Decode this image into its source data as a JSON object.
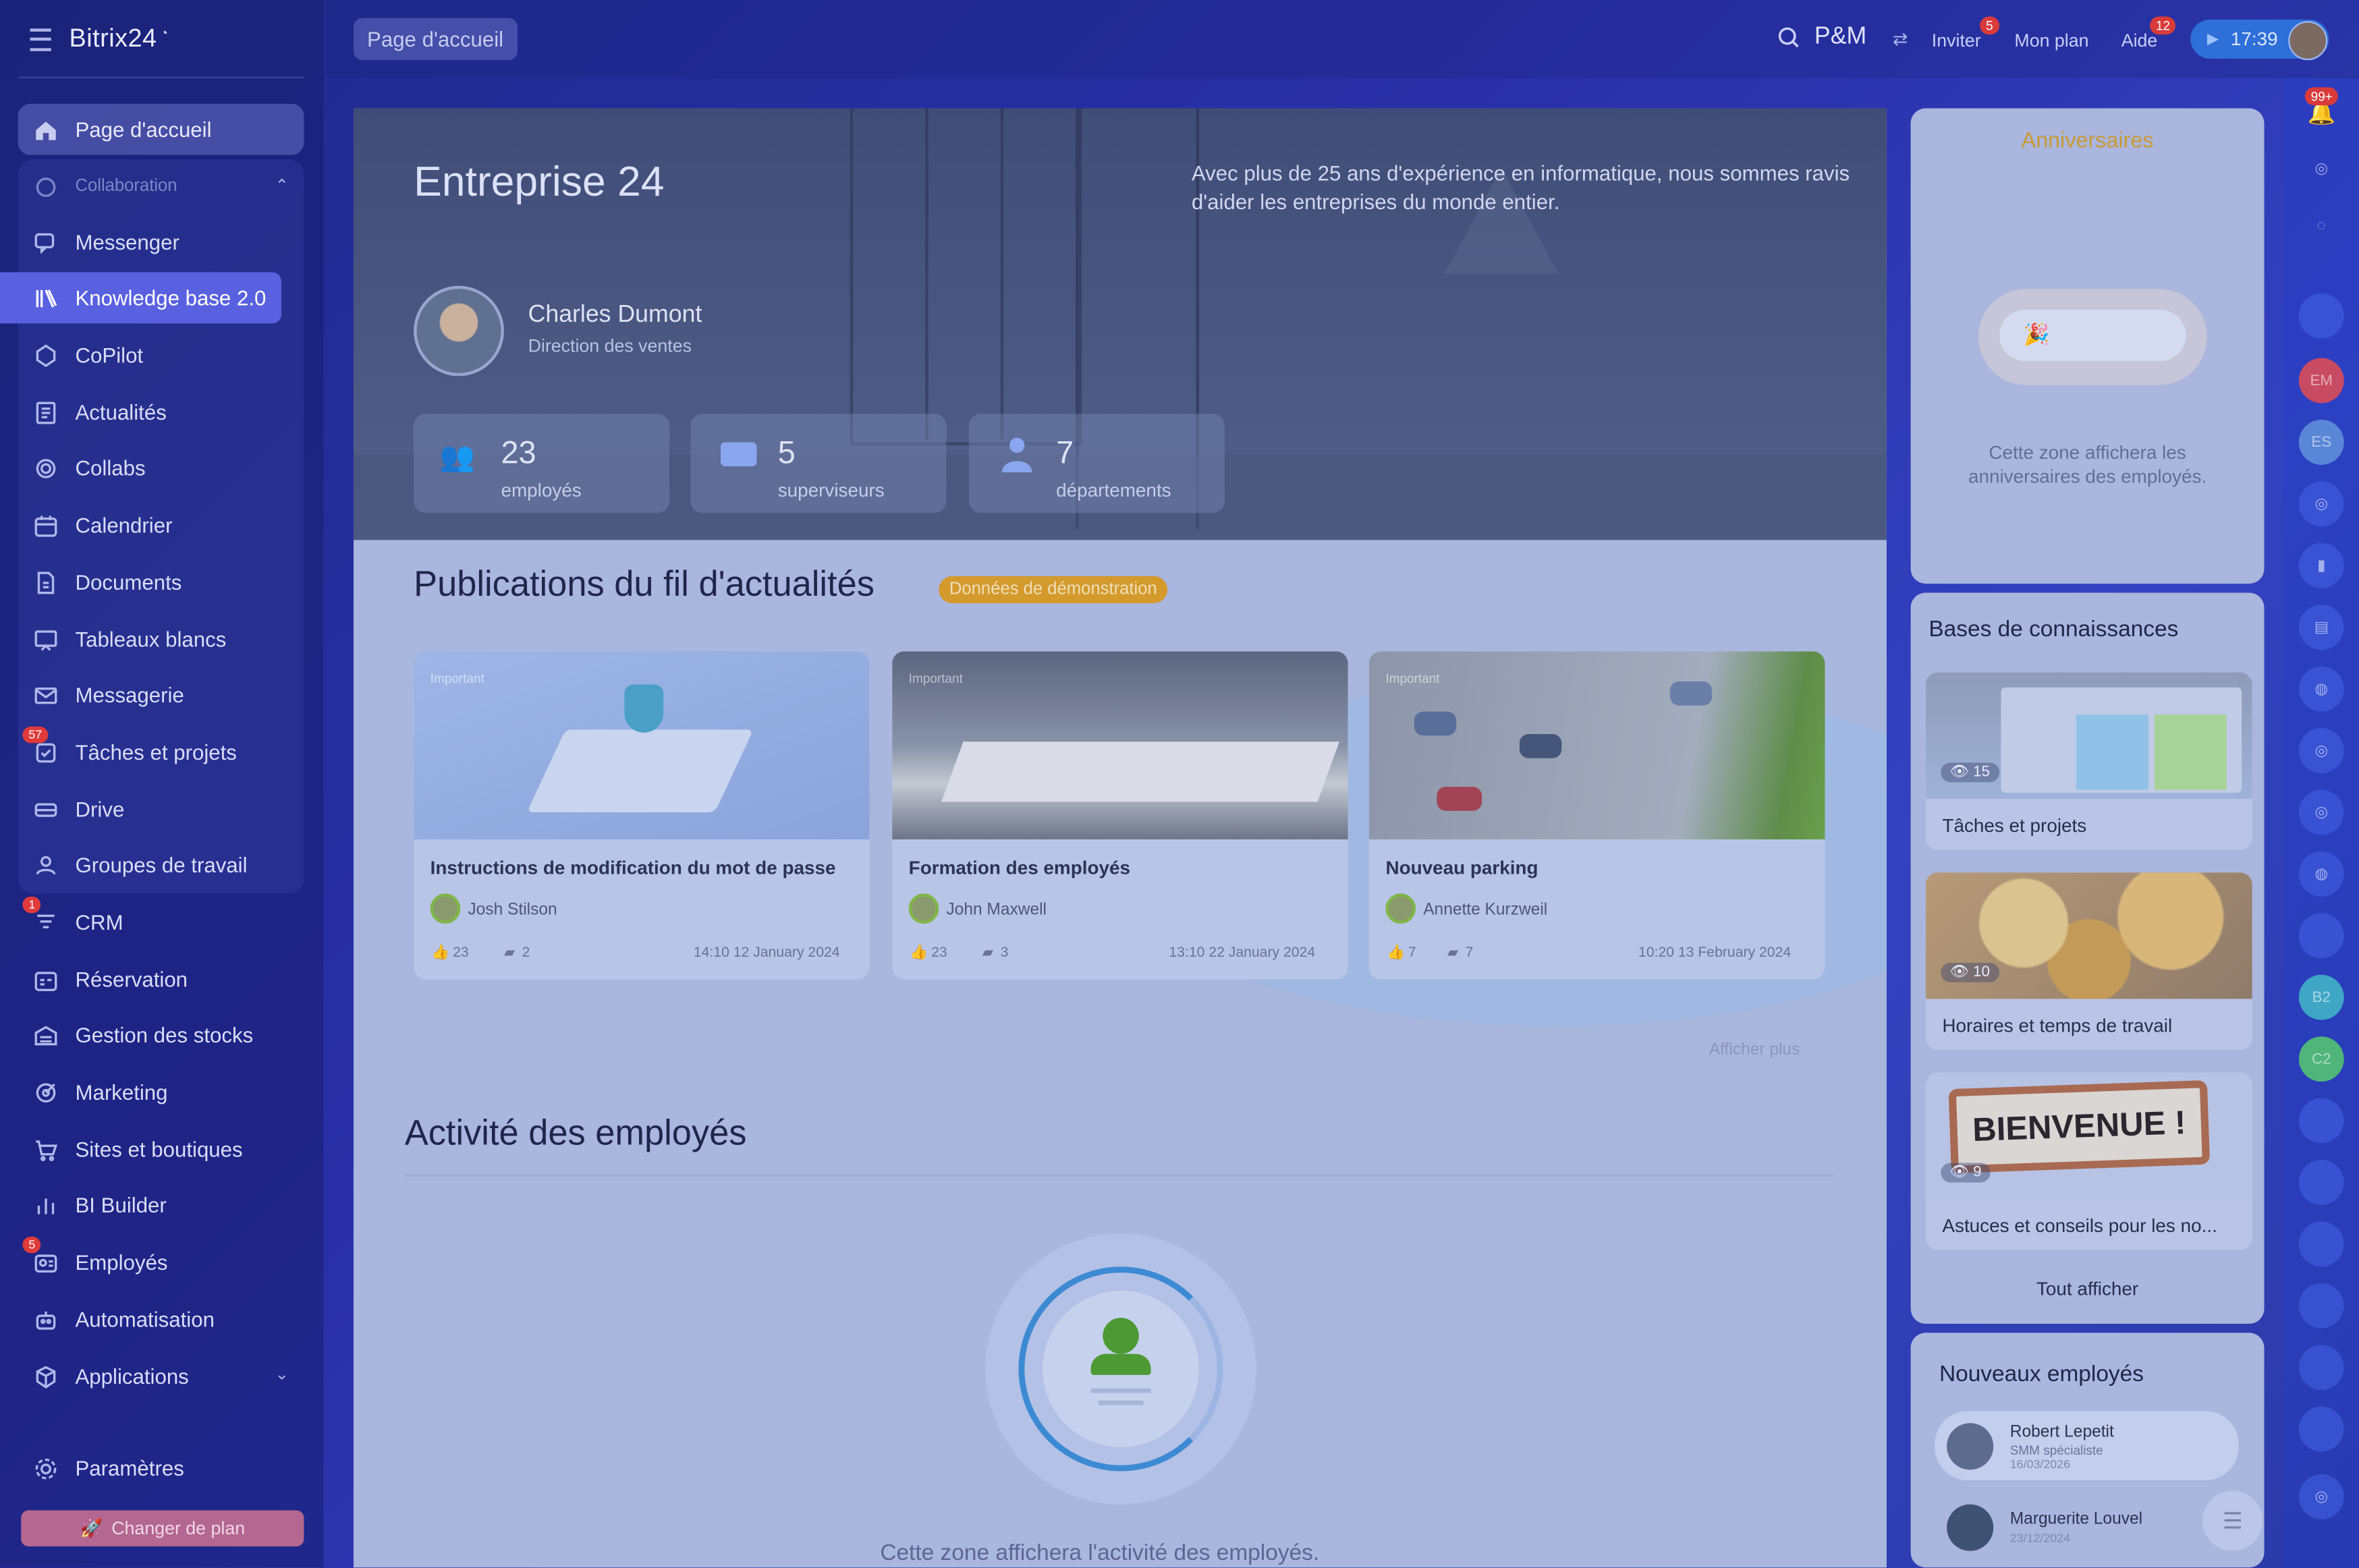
{
  "app": {
    "name": "Bitrix24"
  },
  "header": {
    "breadcrumb": "Page d'accueil",
    "workspace": "P&M",
    "invite_label": "Inviter",
    "invite_badge": "5",
    "plan_label": "Mon plan",
    "help_label": "Aide",
    "help_badge": "12",
    "time": "17:39"
  },
  "sidebar": {
    "group_label": "Collaboration",
    "items": [
      {
        "label": "Page d'accueil",
        "icon": "home-icon"
      },
      {
        "label": "Messenger",
        "icon": "chat-icon"
      },
      {
        "label": "Knowledge base 2.0",
        "icon": "book-icon"
      },
      {
        "label": "CoPilot",
        "icon": "copilot-icon"
      },
      {
        "label": "Actualités",
        "icon": "news-icon"
      },
      {
        "label": "Collabs",
        "icon": "collabs-icon"
      },
      {
        "label": "Calendrier",
        "icon": "calendar-icon"
      },
      {
        "label": "Documents",
        "icon": "document-icon"
      },
      {
        "label": "Tableaux blancs",
        "icon": "whiteboard-icon"
      },
      {
        "label": "Messagerie",
        "icon": "mail-icon"
      },
      {
        "label": "Tâches et projets",
        "icon": "tasks-icon",
        "badge": "57"
      },
      {
        "label": "Drive",
        "icon": "drive-icon"
      },
      {
        "label": "Groupes de travail",
        "icon": "groups-icon"
      },
      {
        "label": "CRM",
        "icon": "crm-icon",
        "badge": "1"
      },
      {
        "label": "Réservation",
        "icon": "booking-icon"
      },
      {
        "label": "Gestion des stocks",
        "icon": "inventory-icon"
      },
      {
        "label": "Marketing",
        "icon": "marketing-icon"
      },
      {
        "label": "Sites et boutiques",
        "icon": "cart-icon"
      },
      {
        "label": "BI Builder",
        "icon": "chart-icon"
      },
      {
        "label": "Employés",
        "icon": "employees-icon",
        "badge": "5"
      },
      {
        "label": "Automatisation",
        "icon": "automation-icon"
      },
      {
        "label": "Applications",
        "icon": "apps-icon"
      }
    ],
    "settings_label": "Paramètres",
    "change_plan_label": "Changer de plan"
  },
  "hero": {
    "company": "Entreprise 24",
    "description": "Avec plus de 25 ans d'expérience en informatique, nous sommes ravis d'aider les entreprises du monde entier.",
    "manager_name": "Charles Dumont",
    "manager_title": "Direction des ventes",
    "stats": [
      {
        "value": "23",
        "label": "employés",
        "icon": "people-icon"
      },
      {
        "value": "5",
        "label": "superviseurs",
        "icon": "id-card-icon"
      },
      {
        "value": "7",
        "label": "départements",
        "icon": "org-icon"
      }
    ]
  },
  "feed": {
    "title": "Publications du fil d'actualités",
    "demo_badge": "Données de démonstration",
    "important_tag": "Important",
    "posts": [
      {
        "title": "Instructions de modification du mot de passe",
        "author": "Josh Stilson",
        "likes": "23",
        "comments": "2",
        "date": "14:10 12 January 2024"
      },
      {
        "title": "Formation des employés",
        "author": "John Maxwell",
        "likes": "23",
        "comments": "3",
        "date": "13:10 22 January 2024"
      },
      {
        "title": "Nouveau parking",
        "author": "Annette Kurzweil",
        "likes": "7",
        "comments": "7",
        "date": "10:20 13 February 2024"
      }
    ],
    "show_more": "Afficher plus"
  },
  "activity": {
    "title": "Activité des employés",
    "empty_text": "Cette zone affichera l'activité des employés."
  },
  "birthdays": {
    "title": "Anniversaires",
    "empty_text": "Cette zone affichera les anniversaires des employés."
  },
  "knowledge": {
    "title": "Bases de connaissances",
    "items": [
      {
        "title": "Tâches et projets",
        "views": "15"
      },
      {
        "title": "Horaires et temps de travail",
        "views": "10"
      },
      {
        "title": "Astuces et conseils pour les no...",
        "views": "9",
        "sign_text": "BIENVENUE !"
      }
    ],
    "show_all": "Tout afficher"
  },
  "new_employees": {
    "title": "Nouveaux employés",
    "items": [
      {
        "name": "Robert Lepetit",
        "role": "SMM spécialiste",
        "date": "16/03/2026"
      },
      {
        "name": "Marguerite Louvel",
        "role": "",
        "date": "23/12/2024"
      }
    ]
  },
  "rail": {
    "notif_badge": "99+",
    "initials": [
      "EM",
      "ES",
      "B2",
      "C2"
    ]
  },
  "colors": {
    "accent": "#5961e0",
    "demo_badge": "#e0a422",
    "anniversary_title": "#d9a53a"
  }
}
